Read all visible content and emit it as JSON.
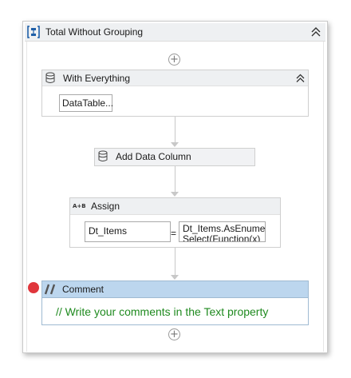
{
  "sequence": {
    "title": "Total Without Grouping",
    "collapse_glyph": "«"
  },
  "with_everything": {
    "title": "With Everything",
    "collapse_glyph": "«",
    "value_button": "DataTable..."
  },
  "add_data_column": {
    "title": "Add Data Column"
  },
  "assign": {
    "title": "Assign",
    "icon_text": "A+B",
    "to_value": "Dt_Items",
    "equals": "=",
    "expression_line1": "Dt_Items.AsEnume",
    "expression_line2": "Select(Function(x)"
  },
  "comment": {
    "title": "Comment",
    "text": "// Write your comments in the Text property"
  },
  "plus_glyph": "+",
  "colors": {
    "comment_text": "#1f8a1f",
    "comment_header": "#bcd6ee",
    "breakpoint": "#e0363c"
  },
  "icons": [
    "sequence-icon",
    "collapse-icon",
    "add-activity-icon",
    "datatable-icon",
    "assign-icon",
    "comment-icon",
    "breakpoint-icon"
  ]
}
